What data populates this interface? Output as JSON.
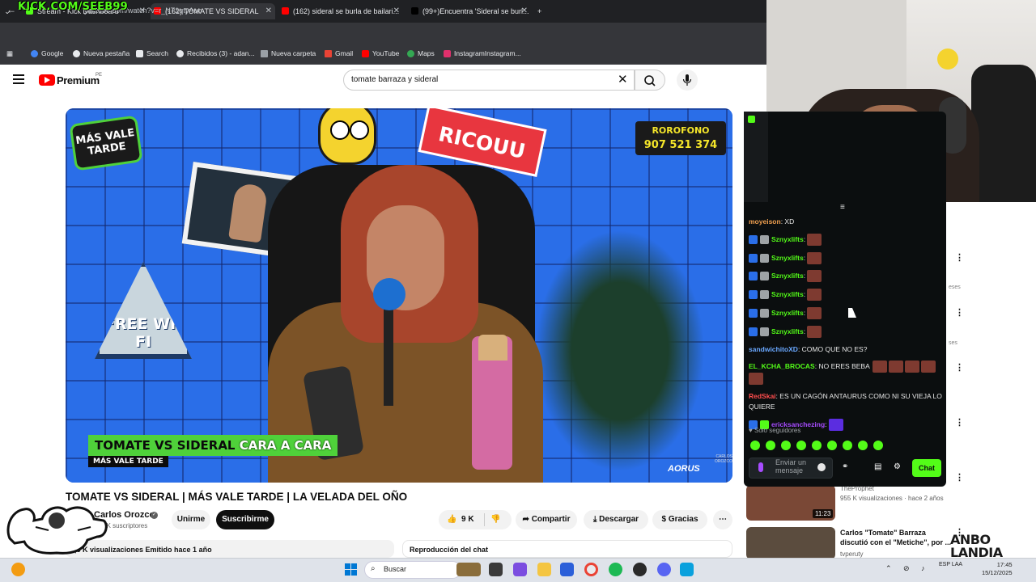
{
  "browser": {
    "tabs": [
      {
        "label": "Stream - Kick Dashboard",
        "active": false,
        "favicon_color": "#53fc18"
      },
      {
        "label": "(162) TOMATE VS SIDERAL",
        "active": true,
        "favicon_color": "#ff0000"
      },
      {
        "label": "(162) sideral se burla de bailari...",
        "active": false,
        "favicon_color": "#ff0000"
      },
      {
        "label": "(99+)Encuentra 'Sideral se burl...",
        "active": false,
        "favicon_color": "#000000"
      }
    ],
    "url": "youtube.com/watch?v=r_NT1qtyAuo",
    "overlay_url": "KICK.COM/SEEB99",
    "bookmarks": [
      "Google",
      "Nueva pestaña",
      "Search",
      "Recibidos (3) - adan...",
      "Nueva carpeta",
      "Gmail",
      "YouTube",
      "Maps",
      "InstagramInstagram..."
    ]
  },
  "youtube": {
    "logo_text": "Premium",
    "logo_sup": "PE",
    "search_value": "tomate barraza y sideral",
    "video": {
      "logo_text": "MÁS VALE TARDE",
      "ricou": "RICOUU",
      "phone_label": "ROROFONO",
      "phone_number": "907 521 374",
      "wifi_text": "FREE WI-FI",
      "banner_main": "TOMATE VS SIDERAL",
      "banner_rest": "CARA A CARA",
      "banner_sub": "MÁS VALE TARDE",
      "aorus": "AORUS",
      "credit": "CARLOS OROZCO"
    },
    "title": "TOMATE VS SIDERAL | MÁS VALE TARDE | LA VELADA DEL OÑO",
    "channel": {
      "name": "Carlos Orozco",
      "subs": "553 K suscriptores"
    },
    "buttons": {
      "join": "Unirme",
      "subscribe": "Suscribirme",
      "likes": "9 K",
      "share": "Compartir",
      "download": "Descargar",
      "thanks": "Gracias"
    },
    "description": "1,5 K visualizaciones  Emitido hace 1 año",
    "chat_replay": "Reproducción del chat",
    "recommended": [
      {
        "channel": "TheProphet",
        "meta": "955 K visualizaciones · hace 2 años",
        "duration": "11:23"
      },
      {
        "title": "Carlos \"Tomate\" Barraza discutió con el \"Metiche\", por ...",
        "channel": "tvperuty"
      }
    ],
    "side_snippets": [
      "eses",
      "ses"
    ]
  },
  "kick_chat": {
    "messages": [
      {
        "user": "moyeison",
        "text": "XD",
        "color": "#f0a050",
        "emotes": 0
      },
      {
        "user": "Sznyxlifts",
        "text": "",
        "color": "#53fc18",
        "emotes": 1,
        "badges": true
      },
      {
        "user": "Sznyxlifts",
        "text": "",
        "color": "#53fc18",
        "emotes": 1,
        "badges": true
      },
      {
        "user": "Sznyxlifts",
        "text": "",
        "color": "#53fc18",
        "emotes": 1,
        "badges": true
      },
      {
        "user": "Sznyxlifts",
        "text": "",
        "color": "#53fc18",
        "emotes": 1,
        "badges": true
      },
      {
        "user": "Sznyxlifts",
        "text": "",
        "color": "#53fc18",
        "emotes": 1,
        "badges": true
      },
      {
        "user": "Sznyxlifts",
        "text": "",
        "color": "#53fc18",
        "emotes": 1,
        "badges": true
      },
      {
        "user": "sandwichitoXD",
        "text": "COMO QUE NO ES?",
        "color": "#6aa8ff",
        "emotes": 0
      },
      {
        "user": "EL_KCHA_BROCAS",
        "text": "NO ERES BEBA",
        "color": "#53fc18",
        "emotes": 5
      },
      {
        "user": "RedSkai",
        "text": "ES UN CAGÓN ANTAURUS COMO NI SU VIEJA LO QUIERE",
        "color": "#ff4d4d",
        "emotes": 0
      },
      {
        "user": "ericksanchezing",
        "text": "",
        "color": "#a74cff",
        "emotes": 1,
        "badges": true,
        "purple": true
      }
    ],
    "mode_label": "Solo seguidores",
    "input_placeholder": "Enviar un mensaje",
    "chat_button": "Chat"
  },
  "overlay": {
    "annbo": "ANBO LANDIA"
  },
  "taskbar": {
    "search_placeholder": "Buscar",
    "lang": "ESP LAA",
    "time": "17:45",
    "date": "15/12/2025"
  }
}
